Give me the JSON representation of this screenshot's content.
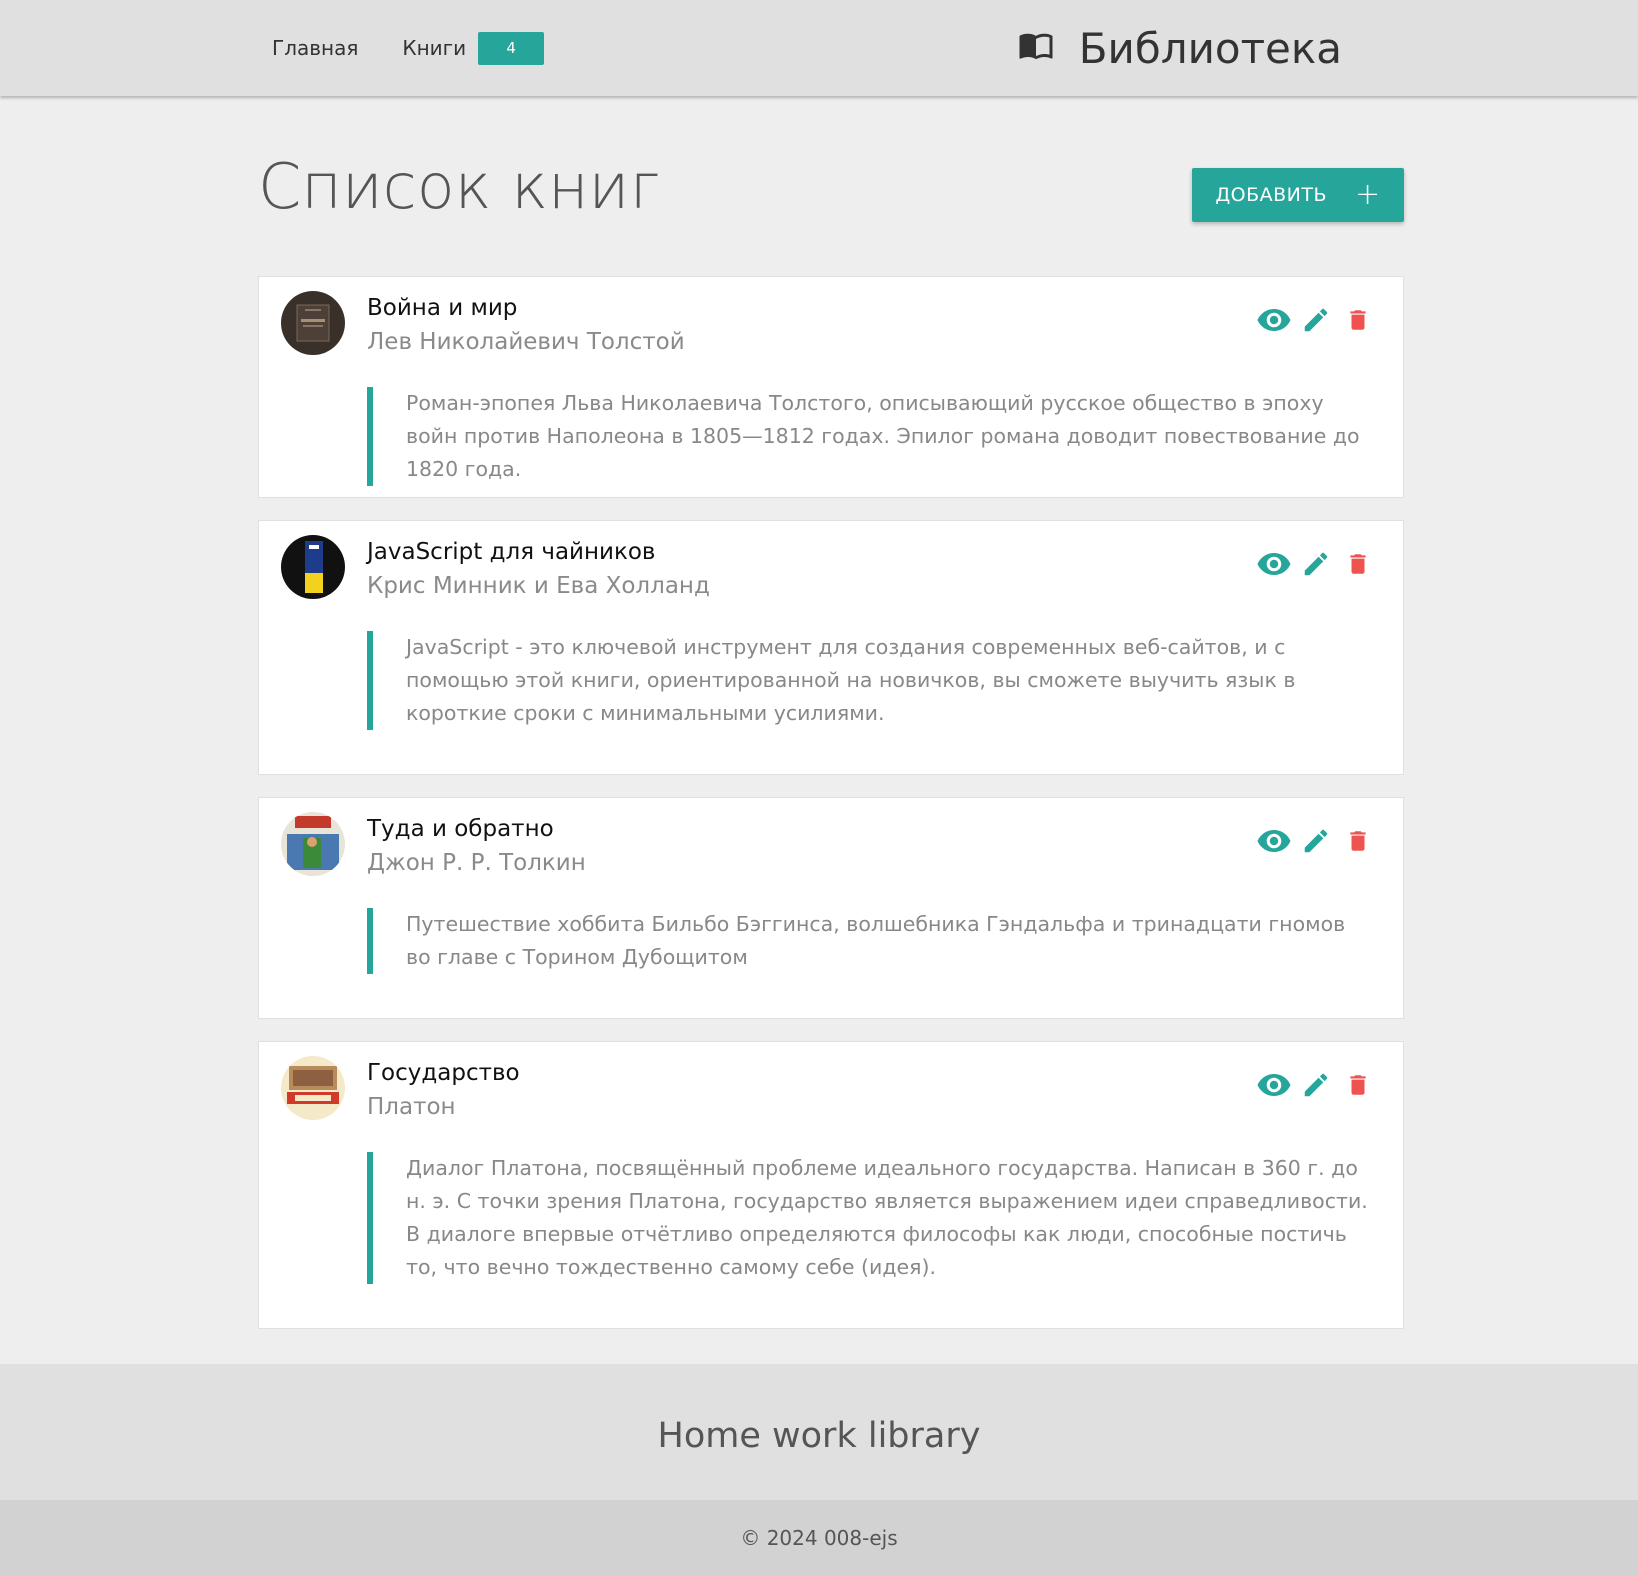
{
  "nav": {
    "home": "Главная",
    "books": "Книги",
    "books_count": "4",
    "brand": "Библиотека",
    "brand_icon": "open-book-icon"
  },
  "page": {
    "title": "Список книг",
    "add_button": "ДОБАВИТЬ",
    "add_icon": "plus-icon"
  },
  "colors": {
    "accent": "#26a69a",
    "danger": "#ef5350",
    "navbar": "#e0e0e0",
    "background": "#eeeeee"
  },
  "books": [
    {
      "title": "Война и мир",
      "author": "Лев Николайевич Толстой",
      "description": "Роман-эпопея Льва Николаевича Толстого, описывающий русское общество в эпоху войн против Наполеона в 1805—1812 годах. Эпилог романа доводит повествование до 1820 года."
    },
    {
      "title": "JavaScript для чайников",
      "author": "Крис Минник и Ева Холланд",
      "description": "JavaScript - это ключевой инструмент для создания современных веб-сайтов, и с помощью этой книги, ориентированной на новичков, вы сможете выучить язык в короткие сроки с минимальными усилиями."
    },
    {
      "title": "Туда и обратно",
      "author": "Джон Р. Р. Толкин",
      "description": "Путешествие хоббита Бильбо Бэггинса, волшебника Гэндальфа и тринадцати гномов во главе с Торином Дубощитом"
    },
    {
      "title": "Государство",
      "author": "Платон",
      "description": "Диалог Платона, посвящённый проблеме идеального государства. Написан в 360 г. до н. э. С точки зрения Платона, государство является выражением идеи справедливости. В диалоге впервые отчётливо определяются философы как люди, способные постичь то, что вечно тождественно самому себе (идея)."
    }
  ],
  "footer": {
    "title": "Home work library",
    "copyright": "© 2024 008-ejs"
  }
}
